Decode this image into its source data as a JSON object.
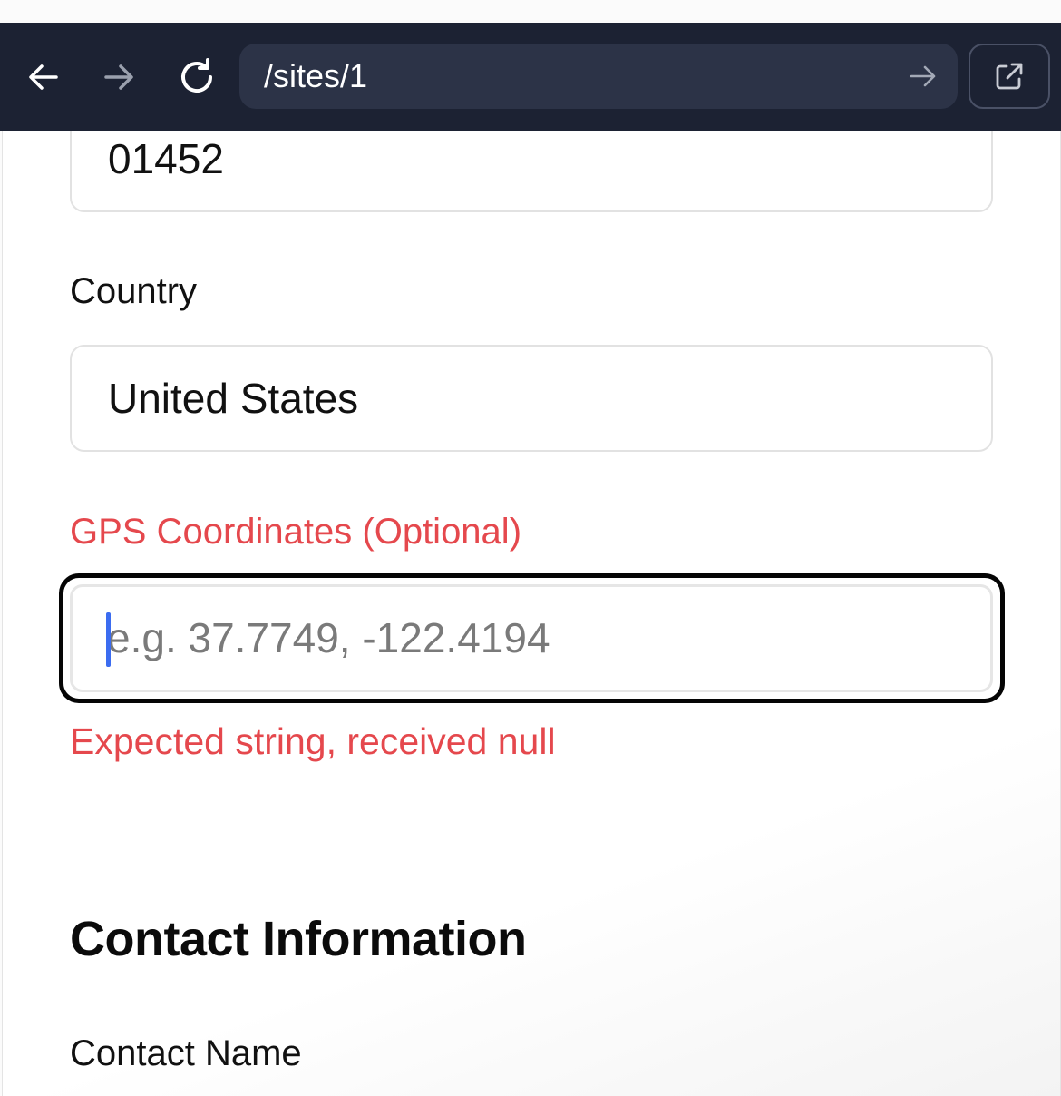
{
  "browser": {
    "url": "/sites/1",
    "colors": {
      "bar": "#1c2233",
      "url_field": "#2c3347"
    },
    "icons": {
      "back": "arrow-left-icon",
      "forward": "arrow-right-icon",
      "reload": "reload-icon",
      "go": "arrow-right-icon",
      "external": "external-link-icon"
    }
  },
  "form": {
    "postal_code": {
      "value": "01452"
    },
    "country": {
      "label": "Country",
      "value": "United States"
    },
    "gps": {
      "label": "GPS Coordinates (Optional)",
      "placeholder": "e.g. 37.7749, -122.4194",
      "value": "",
      "error": "Expected string, received null",
      "state": "focused-invalid"
    },
    "contact": {
      "section_title": "Contact Information",
      "name_label": "Contact Name"
    }
  },
  "colors": {
    "error": "#e5484d",
    "caret": "#3b6cf0",
    "focus_ring": "#050505"
  }
}
